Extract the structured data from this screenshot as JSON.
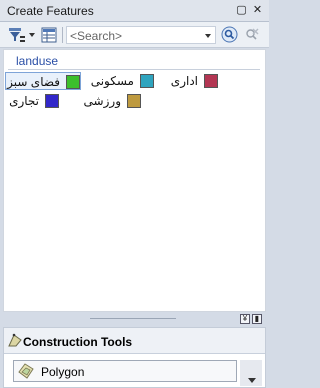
{
  "window": {
    "title": "Create Features",
    "pin_glyph": "▢",
    "close_glyph": "✕"
  },
  "toolbar": {
    "search_placeholder": "<Search>"
  },
  "templates": {
    "layer_name": "landuse",
    "items": [
      {
        "label": "فضای سبز",
        "color": "#3cbf2c",
        "selected": true
      },
      {
        "label": "مسکونی",
        "color": "#2fa4be",
        "selected": false
      },
      {
        "label": "اداری",
        "color": "#b33653",
        "selected": false
      },
      {
        "label": "تجاری",
        "color": "#3227c9",
        "selected": false
      },
      {
        "label": "ورزشی",
        "color": "#be9a3f",
        "selected": false
      }
    ]
  },
  "splitter": {
    "collapse_glyph": "¥",
    "menu_glyph": "▮"
  },
  "construction_tools": {
    "title": "Construction Tools",
    "items": [
      {
        "label": "Polygon"
      }
    ]
  }
}
